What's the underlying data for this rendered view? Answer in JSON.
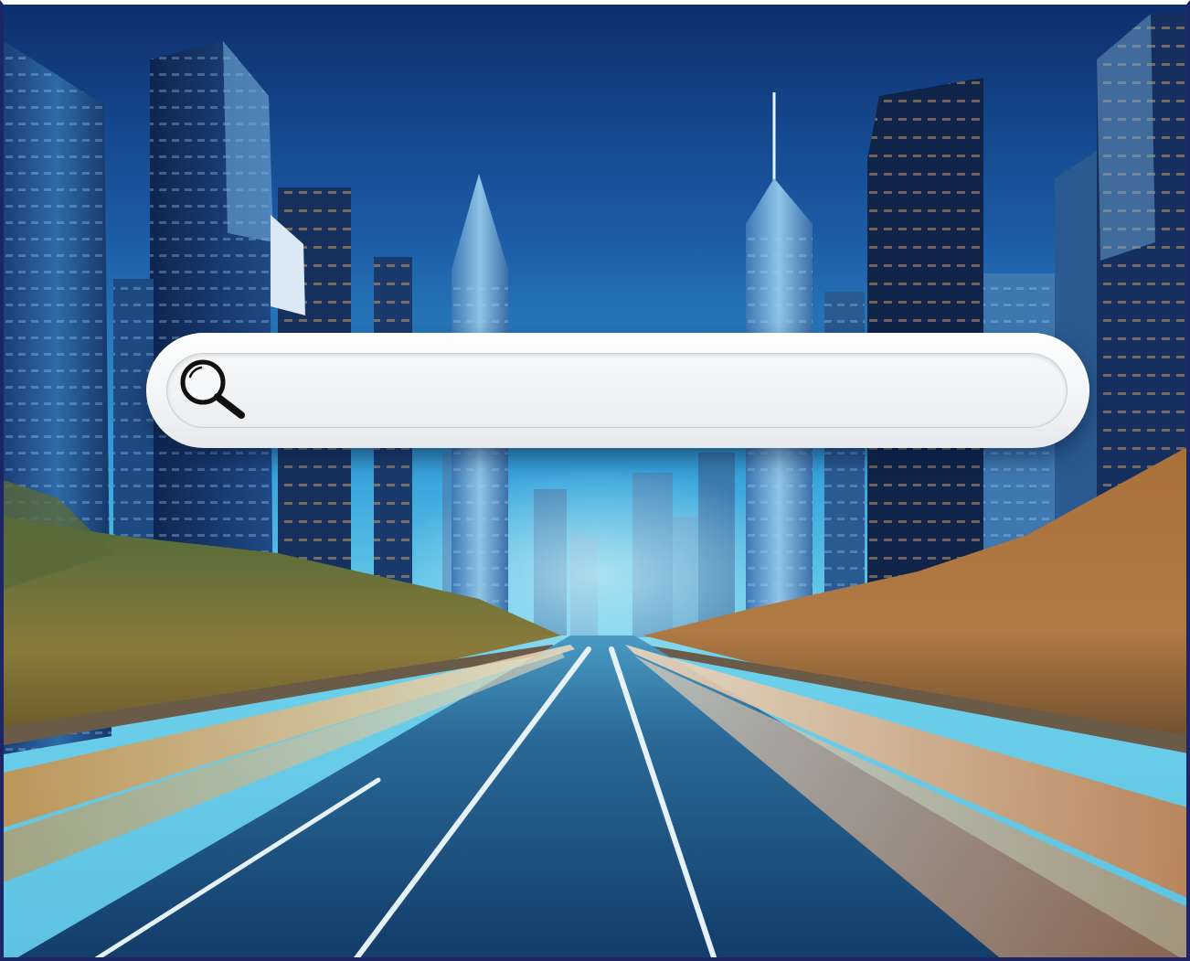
{
  "search": {
    "placeholder": "",
    "value": "",
    "icon": "search-icon"
  },
  "colors": {
    "sky_top": "#0d2f6e",
    "sky_mid": "#2a8fd0",
    "sky_horizon": "#5ad0ee",
    "road": "#1d4b78",
    "foliage": "#a4702f",
    "light_trail_warm": "#f0b27a",
    "search_bar": "#f2f4f6",
    "frame_border": "#1c2566"
  }
}
